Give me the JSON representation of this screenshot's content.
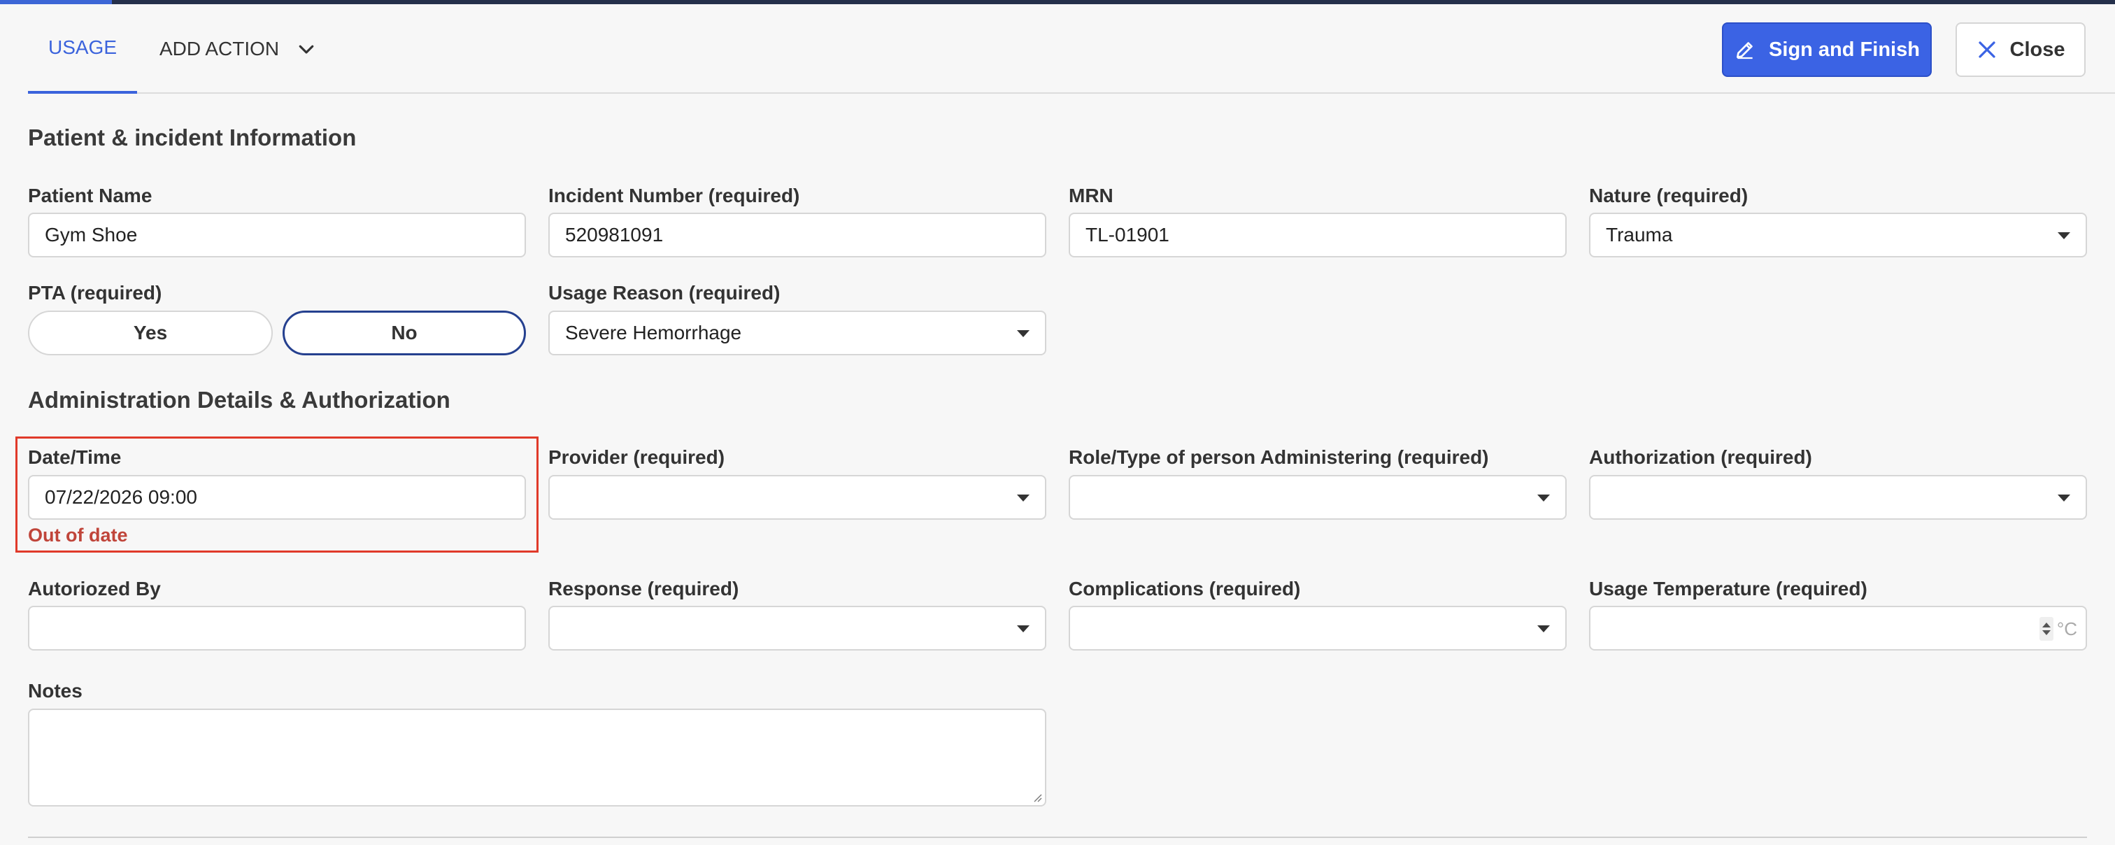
{
  "tabs": {
    "usage": "USAGE",
    "add_action": "ADD ACTION"
  },
  "header_actions": {
    "sign_and_finish": "Sign and Finish",
    "close": "Close"
  },
  "patient_section": {
    "title": "Patient & incident Information",
    "patient_name": {
      "label": "Patient Name",
      "value": "Gym Shoe"
    },
    "incident_number": {
      "label": "Incident Number (required)",
      "value": "520981091"
    },
    "mrn": {
      "label": "MRN",
      "value": "TL-01901"
    },
    "nature": {
      "label": "Nature (required)",
      "value": "Trauma"
    },
    "pta": {
      "label": "PTA (required)",
      "yes": "Yes",
      "no": "No",
      "selected": "No"
    },
    "usage_reason": {
      "label": "Usage Reason (required)",
      "value": "Severe Hemorrhage"
    }
  },
  "admin_section": {
    "title": "Administration Details & Authorization",
    "date_time": {
      "label": "Date/Time",
      "value": "07/22/2026 09:00",
      "error": "Out of date"
    },
    "provider": {
      "label": "Provider (required)",
      "value": ""
    },
    "role_type": {
      "label": "Role/Type of person Administering (required)",
      "value": ""
    },
    "authorization": {
      "label": "Authorization (required)",
      "value": ""
    },
    "authorized_by": {
      "label": "Autoriozed By",
      "value": ""
    },
    "response": {
      "label": "Response (required)",
      "value": ""
    },
    "complications": {
      "label": "Complications (required)",
      "value": ""
    },
    "usage_temperature": {
      "label": "Usage Temperature (required)",
      "value": "",
      "unit": "°C"
    },
    "notes": {
      "label": "Notes",
      "value": ""
    }
  },
  "icons": {
    "sign": "pen-icon",
    "close": "close-x-icon",
    "add_action": "chevron-down-icon",
    "dropdown": "caret-down-icon"
  },
  "colors": {
    "primary": "#3b63e4",
    "tab_active": "#3b63dc",
    "error_border": "#e03a2a",
    "error_text": "#c0453a",
    "selected_toggle": "#25408f"
  }
}
